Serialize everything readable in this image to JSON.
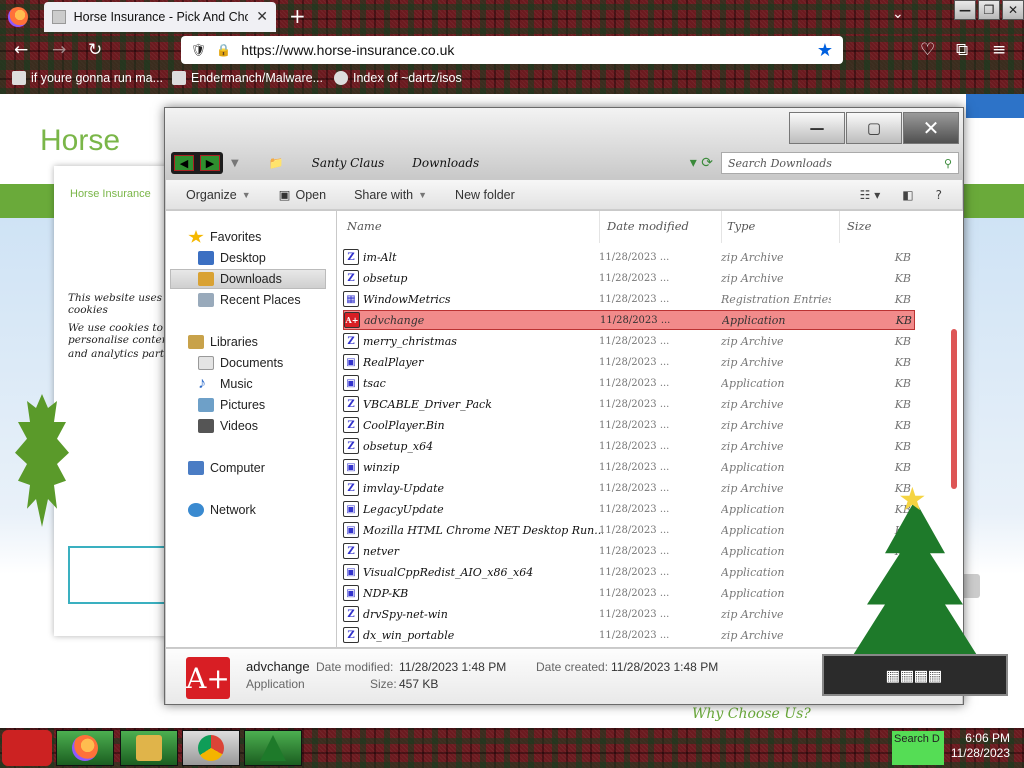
{
  "browser": {
    "tab_title": "Horse Insurance - Pick And Choose",
    "tab_close": "✕",
    "new_tab": "+",
    "url": "https://www.horse-insurance.co.uk",
    "window_controls": [
      "—",
      "❐",
      "✕"
    ],
    "bookmarks": [
      {
        "label": "if youre gonna run ma...",
        "icon": "bookmark-icon"
      },
      {
        "label": "Endermanch/Malware...",
        "icon": "page-icon"
      },
      {
        "label": "Index of ~dartz/isos",
        "icon": "globe-icon"
      }
    ]
  },
  "webpage": {
    "logo": "Horse",
    "cookie_logo": "Horse Insurance",
    "cookie_line1": "This website uses cookies",
    "cookie_line2": "We use cookies to personalise content",
    "cookie_line3": "and analytics partners",
    "why_choose": "Why Choose Us?"
  },
  "explorer": {
    "breadcrumb": [
      "Santy Claus",
      "Downloads"
    ],
    "search_placeholder": "Search Downloads",
    "commands": {
      "organize": "Organize",
      "open": "Open",
      "share_with": "Share with",
      "new_folder": "New folder"
    },
    "nav": {
      "favorites": "Favorites",
      "desktop": "Desktop",
      "downloads": "Downloads",
      "recent": "Recent Places",
      "libraries": "Libraries",
      "documents": "Documents",
      "music": "Music",
      "pictures": "Pictures",
      "videos": "Videos",
      "computer": "Computer",
      "network": "Network"
    },
    "columns": {
      "name": "Name",
      "date": "Date modified",
      "type": "Type",
      "size": "Size"
    },
    "files": [
      {
        "name": "im-Alt",
        "date": "11/28/2023 ...",
        "type": "zip Archive",
        "size": "KB",
        "icon": "archive-icon"
      },
      {
        "name": "obsetup",
        "date": "11/28/2023 ...",
        "type": "zip Archive",
        "size": "KB",
        "icon": "archive-icon"
      },
      {
        "name": "WindowMetrics",
        "date": "11/28/2023 ...",
        "type": "Registration Entries",
        "size": "KB",
        "icon": "registry-icon"
      },
      {
        "name": "advchange",
        "date": "11/28/2023 ...",
        "type": "Application",
        "size": "KB",
        "icon": "app-icon"
      },
      {
        "name": "merry_christmas",
        "date": "11/28/2023 ...",
        "type": "zip Archive",
        "size": "KB",
        "icon": "archive-icon"
      },
      {
        "name": "RealPlayer",
        "date": "11/28/2023 ...",
        "type": "zip Archive",
        "size": "KB",
        "icon": "app-icon"
      },
      {
        "name": "tsac",
        "date": "11/28/2023 ...",
        "type": "Application",
        "size": "KB",
        "icon": "app-icon"
      },
      {
        "name": "VBCABLE_Driver_Pack",
        "date": "11/28/2023 ...",
        "type": "zip Archive",
        "size": "KB",
        "icon": "archive-icon"
      },
      {
        "name": "CoolPlayer.Bin",
        "date": "11/28/2023 ...",
        "type": "zip Archive",
        "size": "KB",
        "icon": "archive-icon"
      },
      {
        "name": "obsetup_x64",
        "date": "11/28/2023 ...",
        "type": "zip Archive",
        "size": "KB",
        "icon": "archive-icon"
      },
      {
        "name": "winzip",
        "date": "11/28/2023 ...",
        "type": "Application",
        "size": "KB",
        "icon": "app-icon"
      },
      {
        "name": "imvlay-Update",
        "date": "11/28/2023 ...",
        "type": "zip Archive",
        "size": "KB",
        "icon": "archive-icon"
      },
      {
        "name": "LegacyUpdate",
        "date": "11/28/2023 ...",
        "type": "Application",
        "size": "KB",
        "icon": "app-icon"
      },
      {
        "name": "Mozilla HTML Chrome NET Desktop Run...",
        "date": "11/28/2023 ...",
        "type": "Application",
        "size": "KB",
        "icon": "app-icon"
      },
      {
        "name": "netver",
        "date": "11/28/2023 ...",
        "type": "Application",
        "size": "KB",
        "icon": "archive-icon"
      },
      {
        "name": "VisualCppRedist_AIO_x86_x64",
        "date": "11/28/2023 ...",
        "type": "Application",
        "size": "KB",
        "icon": "app-icon"
      },
      {
        "name": "NDP-KB",
        "date": "11/28/2023 ...",
        "type": "Application",
        "size": "KB",
        "icon": "app-icon"
      },
      {
        "name": "drvSpy-net-win",
        "date": "11/28/2023 ...",
        "type": "zip Archive",
        "size": "KB",
        "icon": "archive-icon"
      },
      {
        "name": "dx_win_portable",
        "date": "11/28/2023 ...",
        "type": "zip Archive",
        "size": "KB",
        "icon": "archive-icon"
      }
    ],
    "details": {
      "name": "advchange",
      "kind": "Application",
      "date_modified_label": "Date modified:",
      "date_modified": "11/28/2023 1:48 PM",
      "date_created_label": "Date created:",
      "date_created": "11/28/2023 1:48 PM",
      "size_label": "Size:",
      "size": "457 KB"
    }
  },
  "taskbar": {
    "search": "Search D",
    "time": "6:06 PM",
    "date": "11/28/2023"
  },
  "colors": {
    "highlight_row": "#f28b8b",
    "accent_green": "#7ab648",
    "app_icon_red": "#d81e24"
  }
}
